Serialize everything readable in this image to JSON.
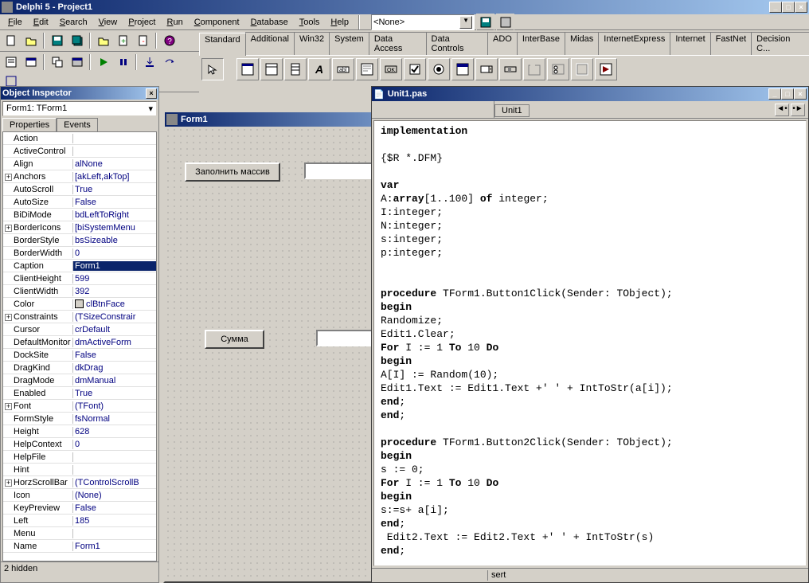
{
  "app": {
    "title": "Delphi 5 - Project1",
    "menus": [
      "File",
      "Edit",
      "Search",
      "View",
      "Project",
      "Run",
      "Component",
      "Database",
      "Tools",
      "Help"
    ],
    "menu_hotkey_idx": [
      0,
      0,
      0,
      0,
      0,
      0,
      0,
      0,
      0,
      0
    ],
    "combo_value": "<None>"
  },
  "palette": {
    "tabs": [
      "Standard",
      "Additional",
      "Win32",
      "System",
      "Data Access",
      "Data Controls",
      "ADO",
      "InterBase",
      "Midas",
      "InternetExpress",
      "Internet",
      "FastNet",
      "Decision C..."
    ],
    "active": 0
  },
  "inspector": {
    "title": "Object Inspector",
    "combo": "Form1: TForm1",
    "tabs": [
      "Properties",
      "Events"
    ],
    "active_tab": 0,
    "status": "2 hidden",
    "selected_index": 11,
    "props": [
      {
        "n": "Action",
        "v": "",
        "t": 0
      },
      {
        "n": "ActiveControl",
        "v": "",
        "t": 0
      },
      {
        "n": "Align",
        "v": "alNone",
        "t": 0
      },
      {
        "n": "Anchors",
        "v": "[akLeft,akTop]",
        "t": 1
      },
      {
        "n": "AutoScroll",
        "v": "True",
        "t": 0
      },
      {
        "n": "AutoSize",
        "v": "False",
        "t": 0
      },
      {
        "n": "BiDiMode",
        "v": "bdLeftToRight",
        "t": 0
      },
      {
        "n": "BorderIcons",
        "v": "[biSystemMenu",
        "t": 1
      },
      {
        "n": "BorderStyle",
        "v": "bsSizeable",
        "t": 0
      },
      {
        "n": "BorderWidth",
        "v": "0",
        "t": 0
      },
      {
        "n": "Caption",
        "v": "Form1",
        "t": 0
      },
      {
        "n": "ClientHeight",
        "v": "599",
        "t": 0
      },
      {
        "n": "ClientWidth",
        "v": "392",
        "t": 0
      },
      {
        "n": "Color",
        "v": "clBtnFace",
        "t": 0,
        "sw": 1
      },
      {
        "n": "Constraints",
        "v": "(TSizeConstrair",
        "t": 1
      },
      {
        "n": "Cursor",
        "v": "crDefault",
        "t": 0
      },
      {
        "n": "DefaultMonitor",
        "v": "dmActiveForm",
        "t": 0
      },
      {
        "n": "DockSite",
        "v": "False",
        "t": 0
      },
      {
        "n": "DragKind",
        "v": "dkDrag",
        "t": 0
      },
      {
        "n": "DragMode",
        "v": "dmManual",
        "t": 0
      },
      {
        "n": "Enabled",
        "v": "True",
        "t": 0
      },
      {
        "n": "Font",
        "v": "(TFont)",
        "t": 1
      },
      {
        "n": "FormStyle",
        "v": "fsNormal",
        "t": 0
      },
      {
        "n": "Height",
        "v": "628",
        "t": 0
      },
      {
        "n": "HelpContext",
        "v": "0",
        "t": 0
      },
      {
        "n": "HelpFile",
        "v": "",
        "t": 0
      },
      {
        "n": "Hint",
        "v": "",
        "t": 0
      },
      {
        "n": "HorzScrollBar",
        "v": "(TControlScrollB",
        "t": 1
      },
      {
        "n": "Icon",
        "v": "(None)",
        "t": 0
      },
      {
        "n": "KeyPreview",
        "v": "False",
        "t": 0
      },
      {
        "n": "Left",
        "v": "185",
        "t": 0
      },
      {
        "n": "Menu",
        "v": "",
        "t": 0
      },
      {
        "n": "Name",
        "v": "Form1",
        "t": 0
      }
    ]
  },
  "form": {
    "title": "Form1",
    "button1": "Заполнить массив",
    "button2": "Сумма"
  },
  "code": {
    "title": "Unit1.pas",
    "tab": "Unit1",
    "status": "sert",
    "lines": [
      {
        "t": "implementation",
        "k": 1
      },
      {
        "t": "",
        "k": 0
      },
      {
        "t": "{$R *.DFM}",
        "k": 0
      },
      {
        "t": "",
        "k": 0
      },
      {
        "t": "var",
        "k": 1
      },
      {
        "t": "A:array[1..100] of integer;",
        "k": 2
      },
      {
        "t": "I:integer;",
        "k": 0
      },
      {
        "t": "N:integer;",
        "k": 0
      },
      {
        "t": "s:integer;",
        "k": 0
      },
      {
        "t": "p:integer;",
        "k": 0
      },
      {
        "t": "",
        "k": 0
      },
      {
        "t": "",
        "k": 0
      },
      {
        "t": "procedure TForm1.Button1Click(Sender: TObject);",
        "k": 3
      },
      {
        "t": "begin",
        "k": 1
      },
      {
        "t": "Randomize;",
        "k": 0
      },
      {
        "t": "Edit1.Clear;",
        "k": 0
      },
      {
        "t": "For I := 1 To 10 Do",
        "k": 4
      },
      {
        "t": "begin",
        "k": 1
      },
      {
        "t": "A[I] := Random(10);",
        "k": 0
      },
      {
        "t": "Edit1.Text := Edit1.Text +' ' + IntToStr(a[i]);",
        "k": 0
      },
      {
        "t": "end;",
        "k": 1
      },
      {
        "t": "end;",
        "k": 1
      },
      {
        "t": "",
        "k": 0
      },
      {
        "t": "procedure TForm1.Button2Click(Sender: TObject);",
        "k": 3
      },
      {
        "t": "begin",
        "k": 1
      },
      {
        "t": "s := 0;",
        "k": 0
      },
      {
        "t": "For I := 1 To 10 Do",
        "k": 4
      },
      {
        "t": "begin",
        "k": 1
      },
      {
        "t": "s:=s+ a[i];",
        "k": 0
      },
      {
        "t": "end;",
        "k": 1
      },
      {
        "t": " Edit2.Text := Edit2.Text +' ' + IntToStr(s)",
        "k": 0
      },
      {
        "t": "end;",
        "k": 1
      }
    ]
  }
}
